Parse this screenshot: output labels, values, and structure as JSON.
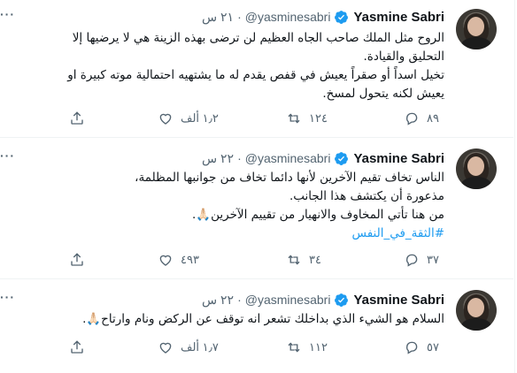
{
  "tweets": [
    {
      "name": "Yasmine Sabri",
      "handle": "@yasminesabri",
      "dot": "·",
      "time": "٢١ س",
      "more": "···",
      "lines": [
        "الروح مثل الملك صاحب الجاه العظيم لن ترضى بهذه الزينة هي لا يرضيها إلا",
        "التحليق والقيادة.",
        " تخيل اسداً أو صقراً يعيش في قفص يقدم له ما يشتهيه احتمالية موته كبيرة او",
        "يعيش لكنه يتحول لمسخ."
      ],
      "hashtag": "",
      "replies": "٨٩",
      "retweets": "١٢٤",
      "likes": "١٫٢ ألف"
    },
    {
      "name": "Yasmine Sabri",
      "handle": "@yasminesabri",
      "dot": "·",
      "time": "٢٢ س",
      "more": "···",
      "lines": [
        "الناس تخاف تقيم الآخرين لأنها دائما تخاف من جوانبها المظلمة،",
        "مذعورة أن يكتشف هذا الجانب.",
        "من هنا تأتي المخاوف والانهيار من تقييم الآخرين🙏🏻."
      ],
      "hashtag": "#الثقة_في_النفس",
      "replies": "٣٧",
      "retweets": "٣٤",
      "likes": "٤٩٣"
    },
    {
      "name": "Yasmine Sabri",
      "handle": "@yasminesabri",
      "dot": "·",
      "time": "٢٢ س",
      "more": "···",
      "lines": [
        "السلام هو الشيء الذي بداخلك تشعر انه توقف عن الركض ونام وارتاح🙏🏻."
      ],
      "hashtag": "",
      "replies": "٥٧",
      "retweets": "١١٢",
      "likes": "١٫٧ ألف"
    }
  ],
  "colors": {
    "verified": "#1d9bf0",
    "muted": "#536471",
    "hashtag": "#1d9bf0",
    "divider": "#eff3f4"
  }
}
